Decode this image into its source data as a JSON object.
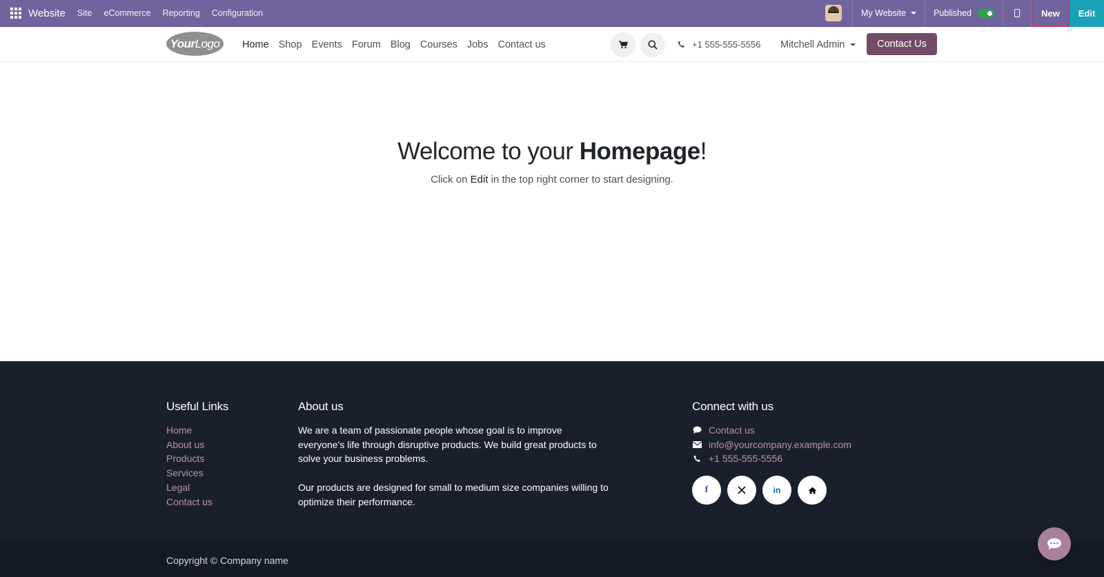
{
  "admin_bar": {
    "app_name": "Website",
    "menus": [
      "Site",
      "eCommerce",
      "Reporting",
      "Configuration"
    ],
    "website_selector": "My Website",
    "published_label": "Published",
    "published": true,
    "new_label": "New",
    "edit_label": "Edit",
    "colors": {
      "bar": "#71639e",
      "edit": "#17a2b8",
      "toggle_on": "#28a745"
    }
  },
  "header": {
    "logo_text_bold": "Your",
    "logo_text": "Logo",
    "nav": [
      "Home",
      "Shop",
      "Events",
      "Forum",
      "Blog",
      "Courses",
      "Jobs",
      "Contact us"
    ],
    "active_nav": "Home",
    "phone": "+1 555-555-5556",
    "user": "Mitchell Admin",
    "cta_label": "Contact Us",
    "cta_color": "#714b67"
  },
  "hero": {
    "title_prefix": "Welcome to your ",
    "title_bold": "Homepage",
    "title_suffix": "!",
    "sub_prefix": "Click on ",
    "sub_bold": "Edit",
    "sub_suffix": " in the top right corner to start designing."
  },
  "footer": {
    "useful_links_title": "Useful Links",
    "useful_links": [
      "Home",
      "About us",
      "Products",
      "Services",
      "Legal",
      "Contact us"
    ],
    "about_title": "About us",
    "about_p1": "We are a team of passionate people whose goal is to improve everyone's life through disruptive products. We build great products to solve your business problems.",
    "about_p2": "Our products are designed for small to medium size companies willing to optimize their performance.",
    "connect_title": "Connect with us",
    "connect_items": [
      {
        "icon": "comment-icon",
        "label": "Contact us"
      },
      {
        "icon": "envelope-icon",
        "label": "info@yourcompany.example.com"
      },
      {
        "icon": "phone-icon",
        "label": "+1 555-555-5556"
      }
    ],
    "socials": [
      "facebook-icon",
      "x-icon",
      "linkedin-icon",
      "home-icon"
    ],
    "copyright": "Copyright © Company name",
    "colors": {
      "background": "#1a1f2e",
      "link": "#b990ad"
    }
  }
}
